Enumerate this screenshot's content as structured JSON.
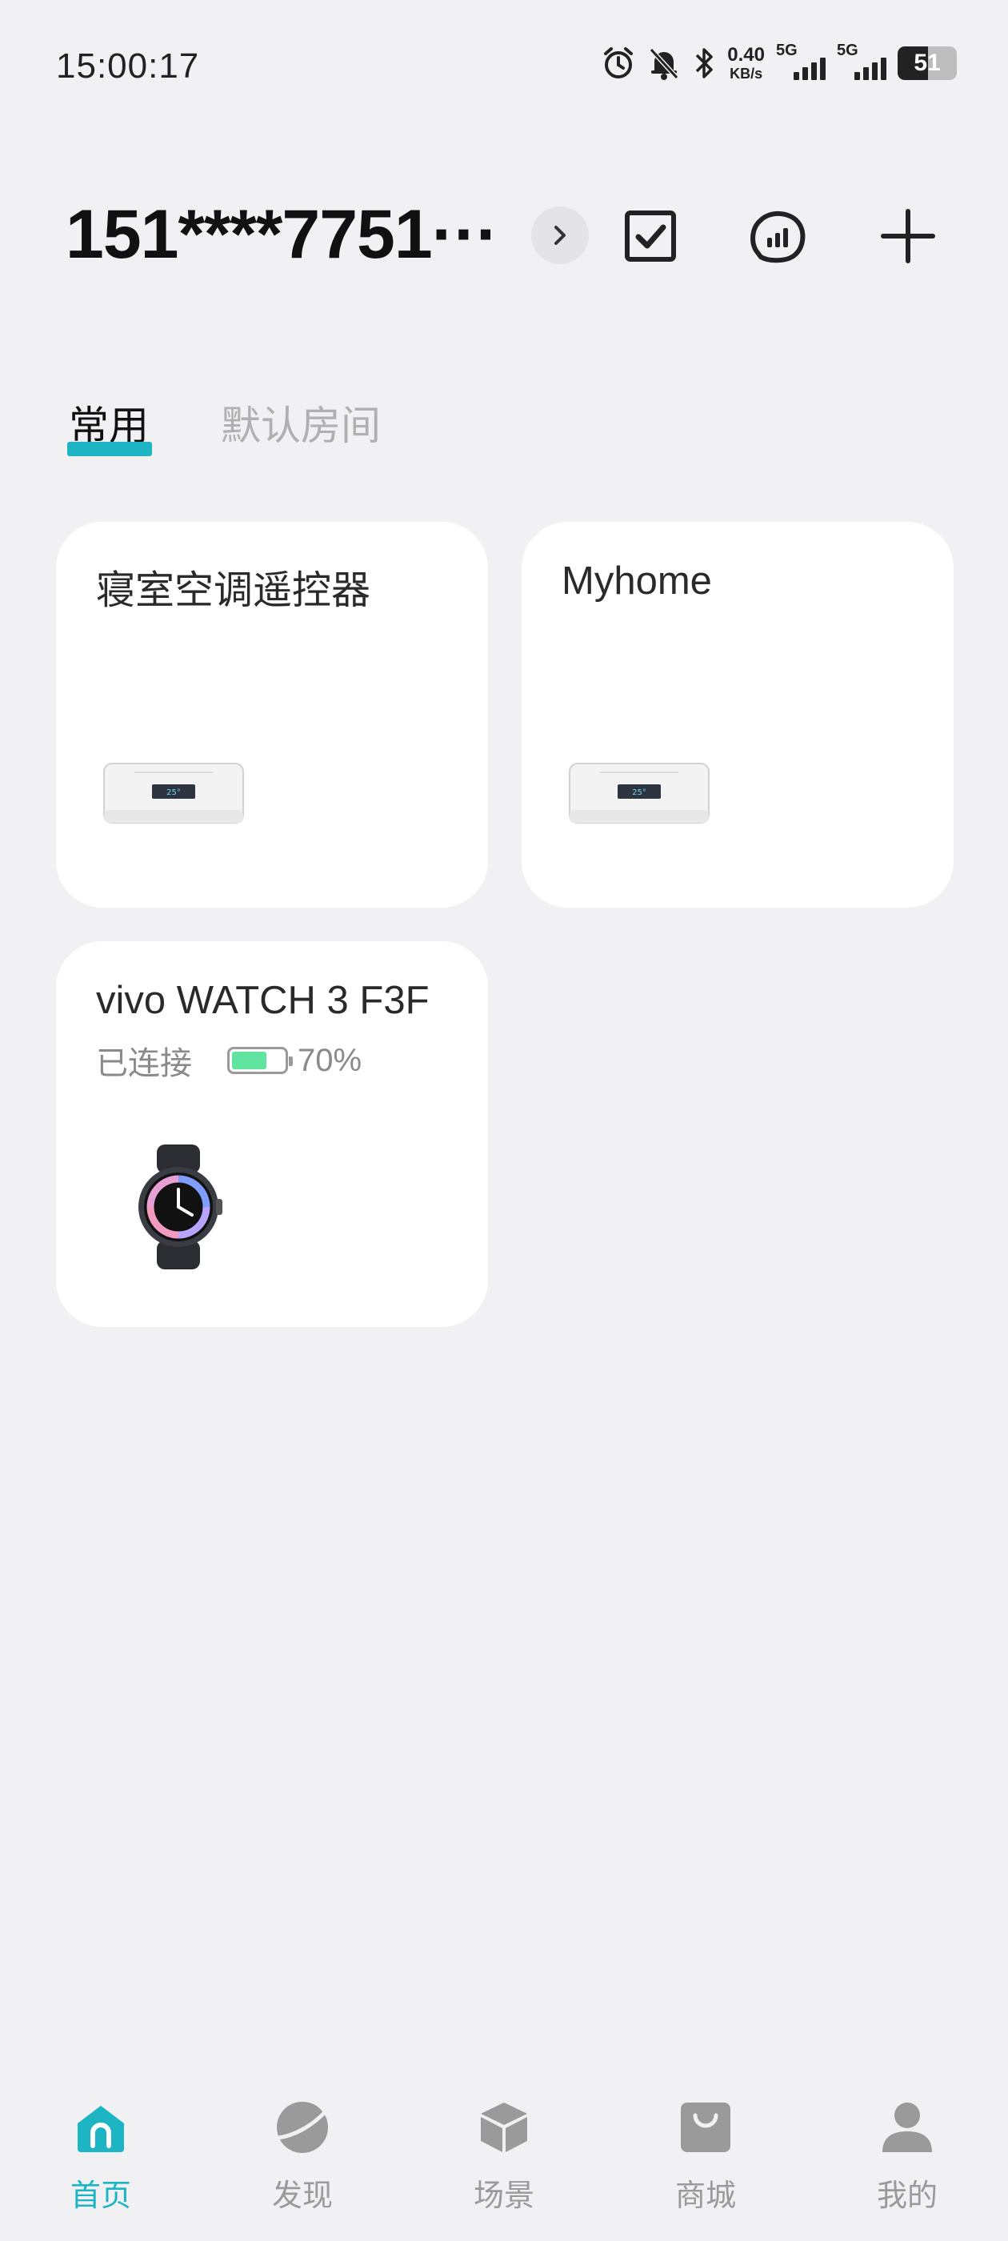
{
  "status_bar": {
    "time": "15:00:17",
    "net_speed_value": "0.40",
    "net_speed_unit": "KB/s",
    "signal1_label": "5G",
    "signal2_label": "5G",
    "battery": "51",
    "battery_level": 0.51
  },
  "header": {
    "home_name": "151****7751···",
    "icons": [
      "chevron-right-icon",
      "checkbox-icon",
      "signal-cloud-icon",
      "plus-icon"
    ]
  },
  "tabs": [
    {
      "label": "常用",
      "active": true
    },
    {
      "label": "默认房间",
      "active": false
    }
  ],
  "devices": [
    {
      "name": "寝室空调遥控器",
      "type": "air-conditioner",
      "display_temp": "25°"
    },
    {
      "name": "Myhome",
      "type": "air-conditioner",
      "display_temp": "25°"
    },
    {
      "name": "vivo WATCH 3 F3F",
      "type": "watch",
      "status": "已连接",
      "battery": "70%",
      "battery_level": 0.7
    }
  ],
  "bottom_nav": [
    {
      "label": "首页",
      "icon": "home-icon",
      "active": true
    },
    {
      "label": "发现",
      "icon": "discover-icon",
      "active": false
    },
    {
      "label": "场景",
      "icon": "scene-cube-icon",
      "active": false
    },
    {
      "label": "商城",
      "icon": "shop-bag-icon",
      "active": false
    },
    {
      "label": "我的",
      "icon": "profile-icon",
      "active": false
    }
  ],
  "colors": {
    "accent": "#1db4c4",
    "background": "#f1f1f3",
    "card": "#ffffff",
    "battery_green": "#5fe39f",
    "inactive": "#9a9a9a"
  }
}
